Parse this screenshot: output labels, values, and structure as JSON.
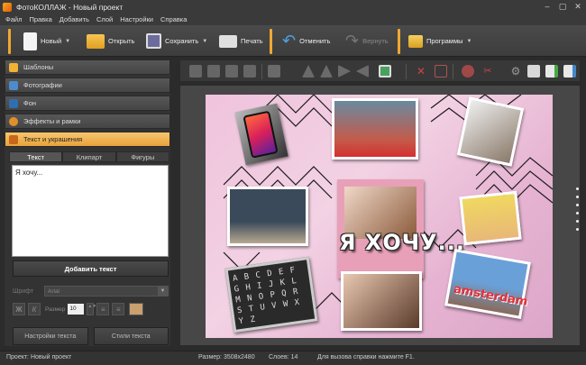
{
  "window": {
    "title": "ФотоКОЛЛАЖ - Новый проект"
  },
  "menu": [
    "Файл",
    "Правка",
    "Добавить",
    "Слой",
    "Настройки",
    "Справка"
  ],
  "toolbar": {
    "new_label": "Новый",
    "open_label": "Открыть",
    "save_label": "Сохранить",
    "print_label": "Печать",
    "undo_label": "Отменить",
    "redo_label": "Вернуть",
    "programs_label": "Программы"
  },
  "sidebar": {
    "sections": [
      "Шаблоны",
      "Фотографии",
      "Фон",
      "Эффекты и рамки",
      "Текст и украшения"
    ],
    "active_section": "Текст и украшения",
    "tabs": [
      "Текст",
      "Клипарт",
      "Фигуры"
    ],
    "active_tab": "Текст",
    "text_value": "Я хочу...",
    "add_text_label": "Добавить текст",
    "font_label": "Шрифт",
    "font_value": "Arial",
    "size_label": "Размер",
    "size_value": "10",
    "bold_glyph": "Ж",
    "italic_glyph": "К",
    "text_settings_label": "Настройки текста",
    "text_styles_label": "Стили текста"
  },
  "collage": {
    "caption": "Я ХОЧУ...",
    "alphabet": [
      "A B C D E F",
      "G H I J K L",
      "M N O P Q R",
      "S T U V W X",
      "Y Z"
    ],
    "city_sign": "amsterdam"
  },
  "status": {
    "project": "Проект:  Новый проект",
    "size": "Размер:  3508x2480",
    "layers": "Слоев:   14",
    "help": "Для вызова справки нажмите F1."
  },
  "colors": {
    "accent": "#f0a830",
    "active_section": "#f7c670",
    "canvas_bg": "#efc3dc"
  }
}
